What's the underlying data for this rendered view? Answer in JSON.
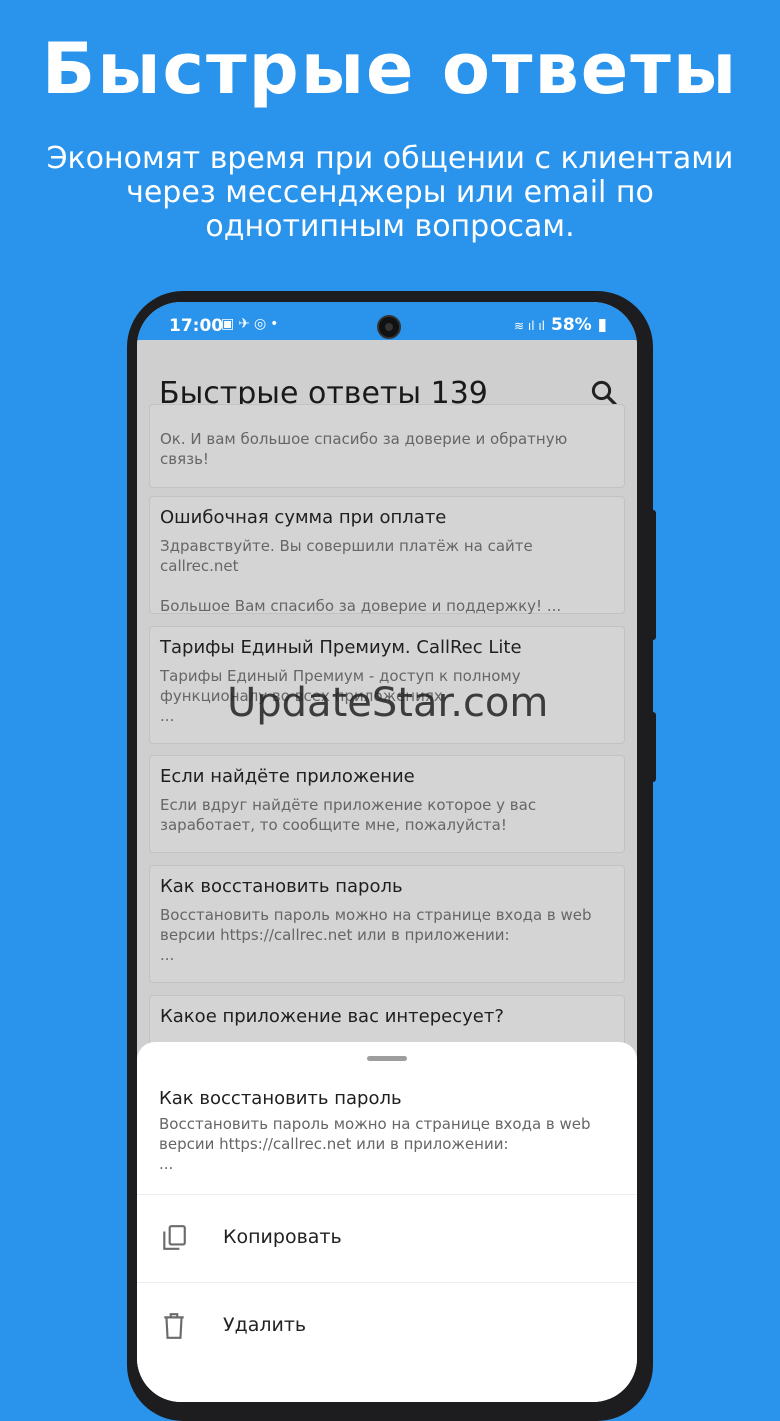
{
  "hero": {
    "title": "Быстрые ответы",
    "subtitle": "Экономят время при общении с клиентами через мессенджеры или email по однотипным вопросам."
  },
  "status": {
    "time": "17:00",
    "battery": "58%"
  },
  "app": {
    "title": "Быстрые ответы 139",
    "search_icon": "search-icon"
  },
  "cards": [
    {
      "title": "",
      "body": "Ок. И вам большое спасибо за доверие и обратную связь!"
    },
    {
      "title": "Ошибочная сумма при оплате",
      "body": "Здравствуйте. Вы совершили платёж на сайте callrec.net\n\nБольшое Вам спасибо за доверие и поддержку! ..."
    },
    {
      "title": "Тарифы Единый Премиум. CallRec Lite",
      "body": "Тарифы Единый Премиум - доступ к полному функционалу во всех приложениях\n ..."
    },
    {
      "title": "Если найдёте приложение",
      "body": "Если вдруг найдёте приложение которое у вас заработает, то сообщите мне, пожалуйста!"
    },
    {
      "title": "Как восстановить пароль",
      "body": "Восстановить пароль можно на странице входа в web версии https://callrec.net или в приложении:\n ..."
    },
    {
      "title": "Какое приложение вас интересует?",
      "body": ""
    }
  ],
  "watermark": "UpdateStar.com",
  "sheet": {
    "title": "Как восстановить пароль",
    "body": "Восстановить пароль можно на странице входа в web версии https://callrec.net или в приложении:\n ...",
    "actions": [
      {
        "label": "Копировать",
        "icon": "copy-icon"
      },
      {
        "label": "Удалить",
        "icon": "trash-icon"
      }
    ]
  }
}
